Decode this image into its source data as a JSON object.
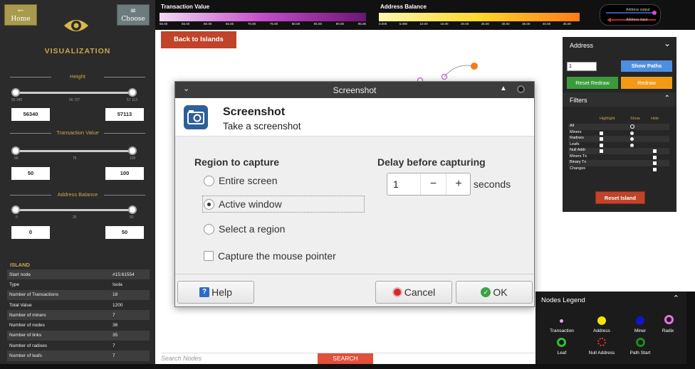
{
  "sidebar": {
    "home_label": "Home",
    "choose_label": "Choose",
    "title": "VISUALIZATION",
    "height": {
      "title": "Height",
      "ticks": [
        "56 340",
        "56 727",
        "57 113"
      ],
      "min": "56340",
      "max": "57113"
    },
    "transaction_value": {
      "title": "Transaction Value",
      "ticks": [
        "50",
        "75",
        "100"
      ],
      "min": "50",
      "max": "100"
    },
    "address_balance": {
      "title": "Address Balance",
      "ticks": [
        "0",
        "25",
        "50"
      ],
      "min": "0",
      "max": "50"
    },
    "island": {
      "title": "ISLAND",
      "rows": [
        {
          "k": "Start node",
          "v": "#15:61554"
        },
        {
          "k": "Type",
          "v": "Isola"
        },
        {
          "k": "Number of Transactions",
          "v": "18"
        },
        {
          "k": "Total Value",
          "v": "1200"
        },
        {
          "k": "Number of miners",
          "v": "7"
        },
        {
          "k": "Number of nodes",
          "v": "36"
        },
        {
          "k": "Number of links",
          "v": "35"
        },
        {
          "k": "Number of radixes",
          "v": "7"
        },
        {
          "k": "Number of leafs",
          "v": "7"
        }
      ]
    }
  },
  "topbar": {
    "tv_title": "Transaction Value",
    "tv_ticks": [
      "50.00",
      "55.00",
      "60.00",
      "65.00",
      "70.00",
      "75.00",
      "80.00",
      "85.00",
      "90.00",
      "95.00"
    ],
    "ab_title": "Address Balance",
    "ab_ticks": [
      "0.000",
      "5.000",
      "10.00",
      "15.00",
      "20.00",
      "25.00",
      "30.00",
      "35.00",
      "40.00",
      "45.00"
    ],
    "edge_output": "Address output",
    "edge_input": "Address input"
  },
  "main": {
    "back_label": "Back to Islands"
  },
  "address_panel": {
    "title": "Address",
    "input_value": "1",
    "show_paths": "Show Paths",
    "reset_redraw": "Reset Redraw",
    "redraw": "Redraw",
    "filters_title": "Filters",
    "col_highlight": "Highlight",
    "col_show": "Show",
    "col_hide": "Hide",
    "filter_rows": [
      "All",
      "Miners",
      "Radixes",
      "Leafs",
      "Null Addr",
      "Miners Tx",
      "Binary Tx",
      "Changes"
    ],
    "reset_island": "Reset Island"
  },
  "nodes_legend": {
    "title": "Nodes Legend",
    "items": [
      "Transaction",
      "Address",
      "Miner",
      "Radix",
      "Leaf",
      "Null Address",
      "Path Start"
    ]
  },
  "search": {
    "placeholder": "Search Nodes",
    "button": "SEARCH"
  },
  "dialog": {
    "window_title": "Screenshot",
    "heading": "Screenshot",
    "subheading": "Take a screenshot",
    "region_title": "Region to capture",
    "options": [
      "Entire screen",
      "Active window",
      "Select a region"
    ],
    "selected_option": "Active window",
    "capture_pointer": "Capture the mouse pointer",
    "delay_title": "Delay before capturing",
    "delay_value": "1",
    "delay_unit": "seconds",
    "help": "Help",
    "cancel": "Cancel",
    "ok": "OK"
  }
}
